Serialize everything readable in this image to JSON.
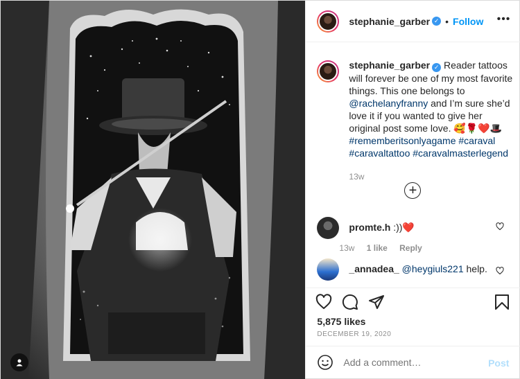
{
  "header": {
    "username": "stephanie_garber",
    "dot": "•",
    "follow_label": "Follow",
    "more_icon": "ellipsis-icon"
  },
  "caption": {
    "username": "stephanie_garber",
    "text_1": "Reader tattoos will forever be one of my most favorite things. This one belongs to",
    "mention": "@rachelanyfranny",
    "text_2": "and I’m sure she’d love it if you wanted to give her original post some love.",
    "emoji": "🥰🌹❤️🎩",
    "hashtags": [
      "#rememberitsonlyagame",
      "#caraval",
      "#caravaltattoo",
      "#caravalmasterlegend"
    ],
    "time": "13w"
  },
  "load_more_icon": "plus-circle-icon",
  "comments": [
    {
      "username": "promte.h",
      "text": ":))❤️",
      "time": "13w",
      "likes": "1 like",
      "reply": "Reply"
    },
    {
      "username": "_annadea_",
      "mention": "@heygiuls221",
      "text": "help."
    }
  ],
  "actions": {
    "icons": [
      "heart-icon",
      "comment-icon",
      "share-icon",
      "bookmark-icon"
    ]
  },
  "likes_label": "5,875 likes",
  "date": "DECEMBER 19, 2020",
  "add_comment": {
    "placeholder": "Add a comment…",
    "post_label": "Post",
    "emoji_icon": "smiley-icon"
  },
  "colors": {
    "link": "#0095f6",
    "mention": "#00376b",
    "muted": "#8e8e8e",
    "like_heart": "#ed4956"
  }
}
